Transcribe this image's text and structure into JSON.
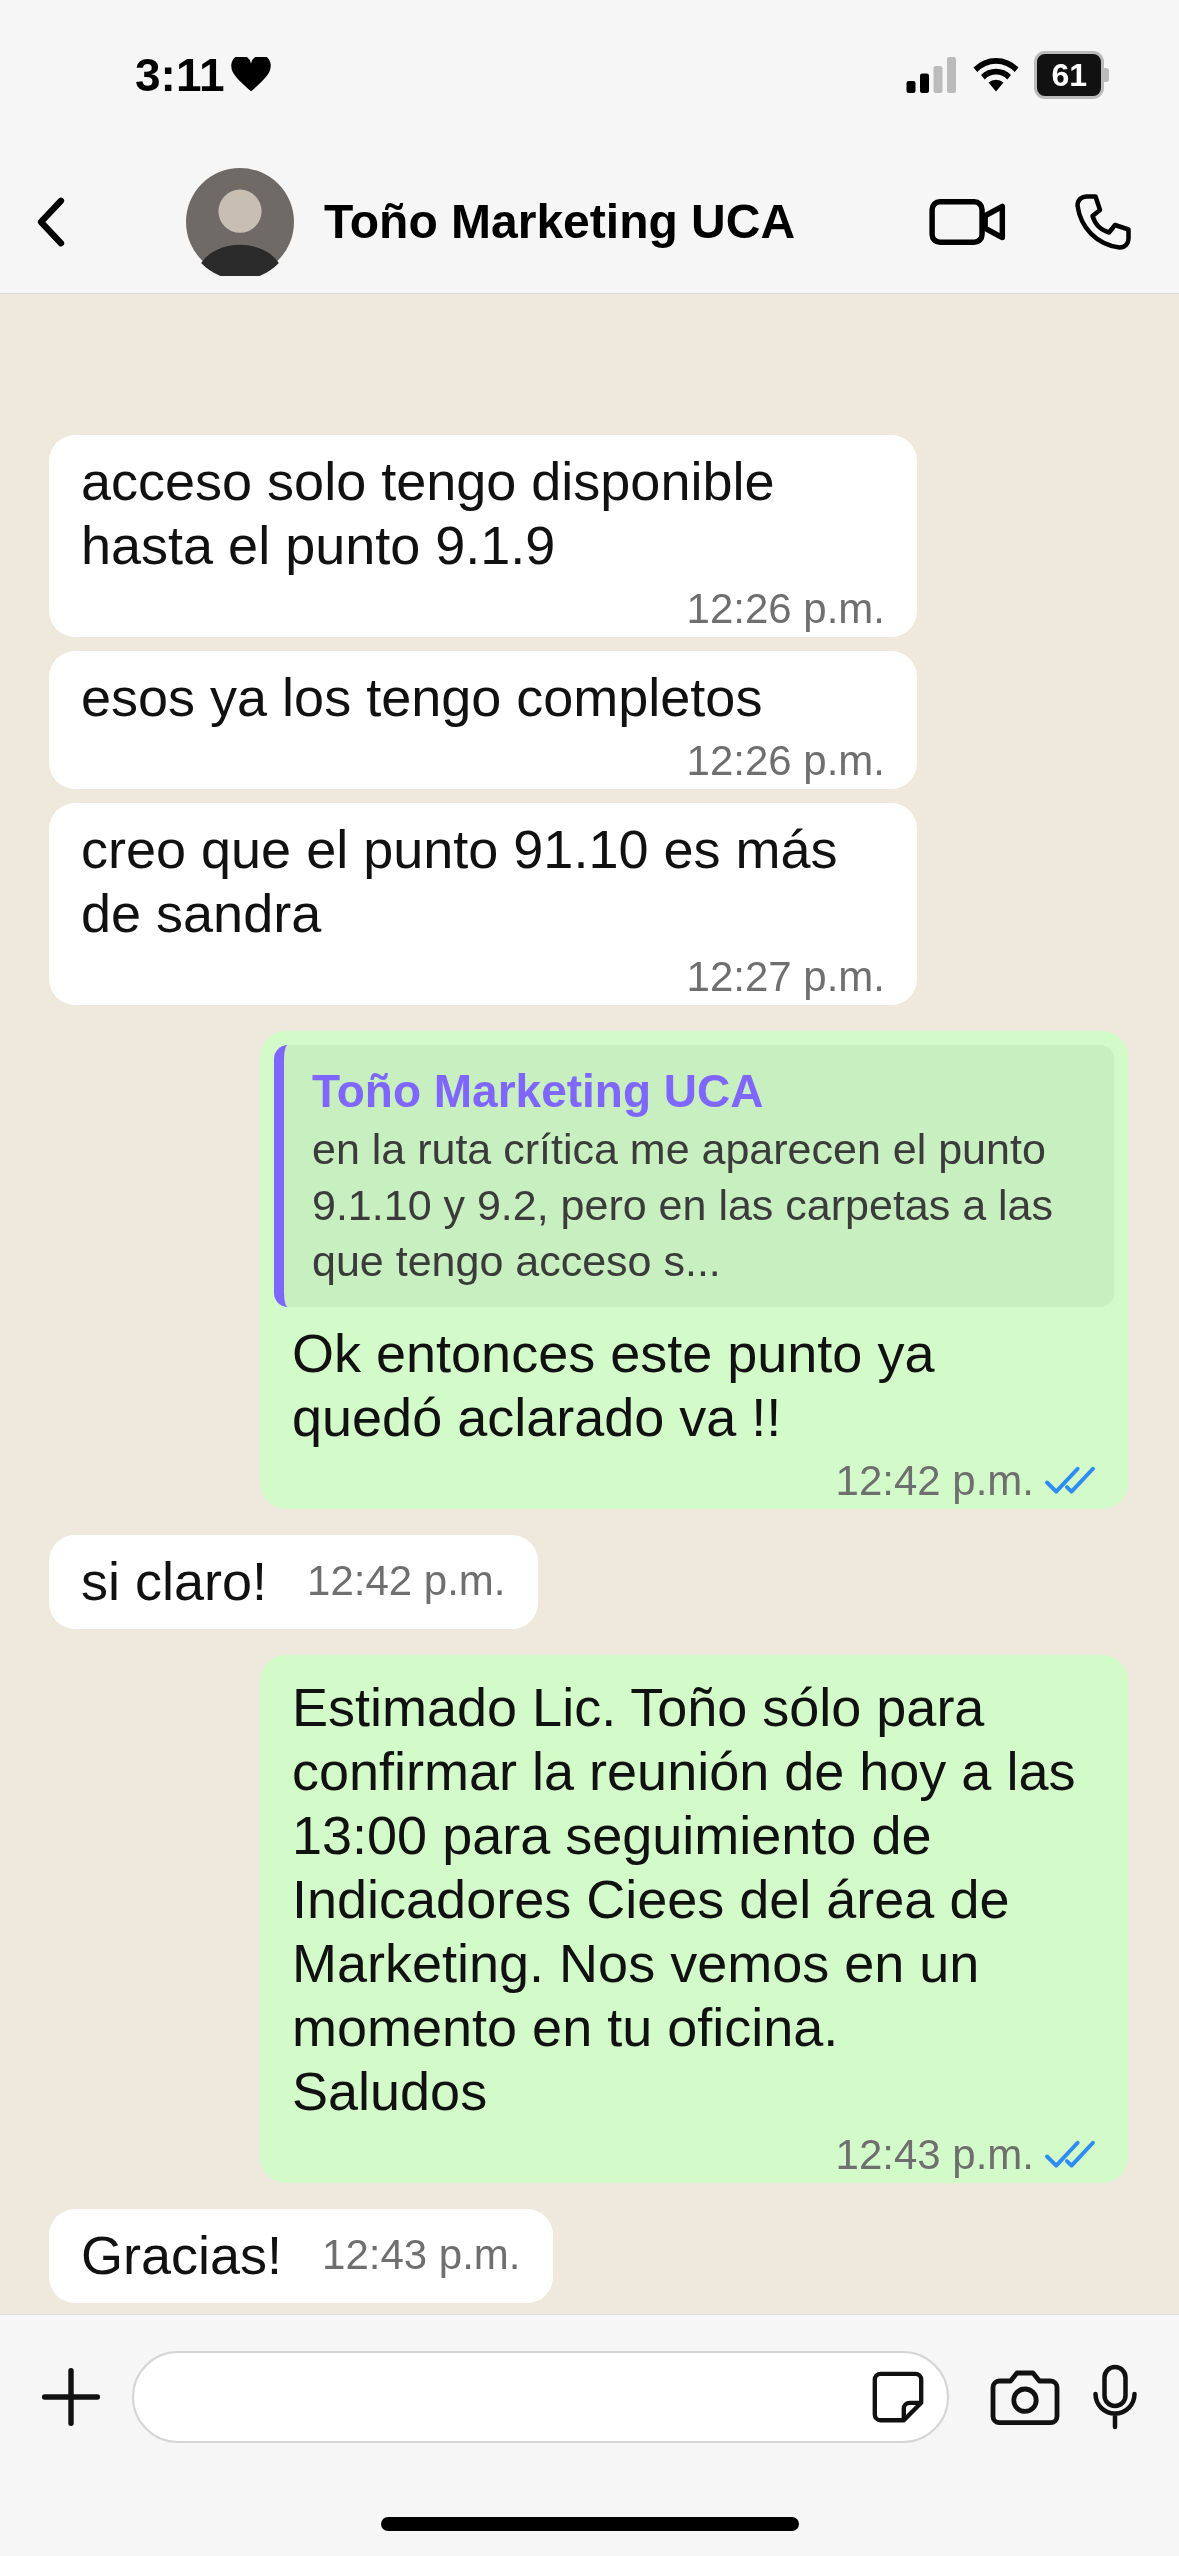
{
  "status_bar": {
    "time": "3:11",
    "battery": "61"
  },
  "header": {
    "contact_name": "Toño Marketing UCA"
  },
  "messages": [
    {
      "kind": "incoming",
      "text": "acceso solo tengo disponible hasta el punto 9.1.9",
      "time": "12:26 p.m."
    },
    {
      "kind": "incoming",
      "text": "esos ya los tengo completos",
      "time": "12:26 p.m."
    },
    {
      "kind": "incoming",
      "text": "creo que el punto 91.10 es más de sandra",
      "time": "12:27 p.m."
    },
    {
      "kind": "outgoing",
      "quote": {
        "author": "Toño Marketing UCA",
        "text": "en la ruta crítica me aparecen el punto 9.1.10 y 9.2, pero en las carpetas a las que tengo acceso s..."
      },
      "text": "Ok entonces este punto ya quedó aclarado va !!",
      "time": "12:42 p.m.",
      "read": true
    },
    {
      "kind": "incoming",
      "text": "si claro!",
      "time": "12:42 p.m."
    },
    {
      "kind": "outgoing",
      "text": "Estimado Lic. Toño sólo para confirmar la reunión de hoy a las 13:00 para seguimiento de Indicadores Ciees del área de Marketing. Nos vemos en un momento en tu oficina.\nSaludos",
      "time": "12:43 p.m.",
      "read": true
    },
    {
      "kind": "incoming",
      "text": "Gracias!",
      "time": "12:43 p.m."
    }
  ]
}
